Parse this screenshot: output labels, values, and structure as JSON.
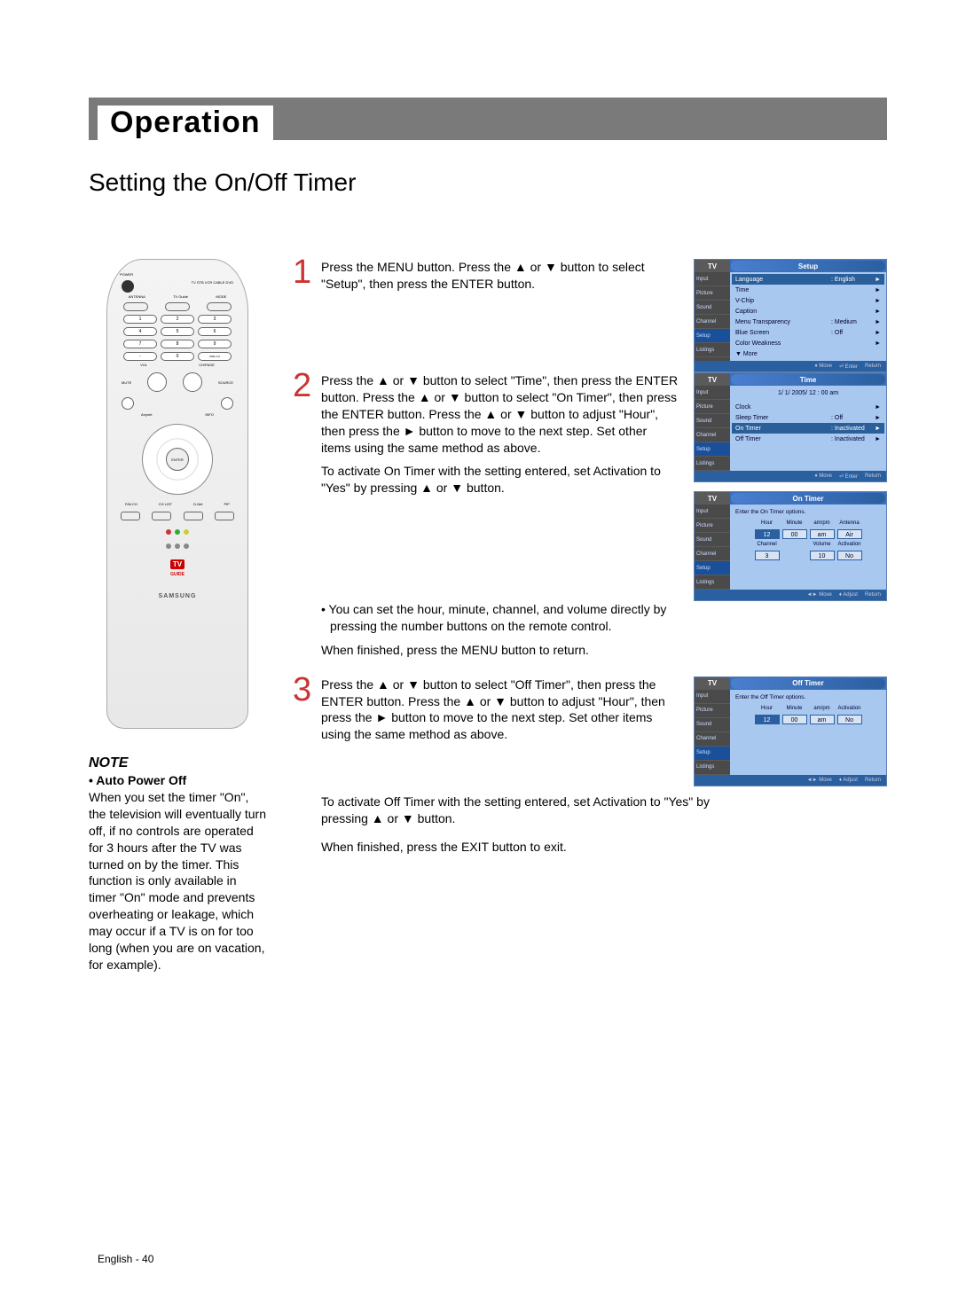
{
  "page": {
    "section": "Operation",
    "subtitle": "Setting the On/Off Timer",
    "footer": "English - 40"
  },
  "note": {
    "heading": "NOTE",
    "sub_bullet": "• Auto Power Off",
    "body": "When you set the timer \"On\", the television will eventually turn off, if no controls are operated for 3 hours after the TV was turned on by the timer. This function is only available in timer \"On\" mode and prevents overheating or leakage, which may occur if a TV is on for too long (when you are on vacation, for example)."
  },
  "remote": {
    "power_label": "POWER",
    "devices": "TV  STB  VCR  CABLE  DVD",
    "row1": [
      "ANTENNA",
      "TV Guide",
      "MODE"
    ],
    "numbers": [
      "1",
      "2",
      "3",
      "4",
      "5",
      "6",
      "7",
      "8",
      "9",
      "-",
      "0",
      "PRE-CH"
    ],
    "vol": "VOL",
    "ch": "CH/PAGE",
    "mute": "MUTE",
    "source": "SOURCE",
    "anynet": "Anynet",
    "info": "INFO",
    "enter": "ENTER",
    "bottom": [
      "FAV.CH",
      "CH LIST",
      "D-Net",
      "PIP"
    ],
    "tv_guide_logo": "TV GUIDE",
    "brand": "SAMSUNG"
  },
  "steps": {
    "s1": {
      "num": "1",
      "text": "Press the MENU button. Press the ▲ or ▼ button to select \"Setup\", then press the ENTER button."
    },
    "s2": {
      "num": "2",
      "text1": "Press the ▲ or ▼ button to select \"Time\", then press the ENTER button. Press the ▲ or ▼ button to select \"On Timer\", then press the ENTER button. Press the ▲ or ▼ button to adjust \"Hour\", then press the ► button to move to the next step. Set other items using the same method as above.",
      "text2": "To activate On Timer with the setting entered, set Activation to \"Yes\" by pressing ▲ or ▼ button."
    },
    "s2_bullet": "• You can set the hour, minute, channel, and volume directly by pressing the number buttons on the remote control.",
    "s2_tail": "When finished, press the MENU button to return.",
    "s3": {
      "num": "3",
      "text": "Press the ▲ or ▼ button to select \"Off Timer\", then press the ENTER button. Press the ▲ or ▼ button to adjust \"Hour\", then press the ► button to move to the next step. Set other items using the same method as above."
    },
    "s3_tail1": "To activate Off Timer with the setting entered, set Activation to \"Yes\" by pressing ▲ or ▼ button.",
    "s3_tail2": "When finished, press the EXIT button to exit."
  },
  "osd_common": {
    "tv": "TV",
    "side_items": [
      "Input",
      "Picture",
      "Sound",
      "Channel",
      "Setup",
      "Listings"
    ],
    "foot_move": "Move",
    "foot_enter": "Enter",
    "foot_return": "Return",
    "foot_adjust": "Adjust"
  },
  "osd_setup": {
    "title": "Setup",
    "rows": [
      {
        "l": "Language",
        "v": ": English"
      },
      {
        "l": "Time",
        "v": ""
      },
      {
        "l": "V-Chip",
        "v": ""
      },
      {
        "l": "Caption",
        "v": ""
      },
      {
        "l": "Menu Transparency",
        "v": ": Medium"
      },
      {
        "l": "Blue Screen",
        "v": ": Off"
      },
      {
        "l": "Color Weakness",
        "v": ""
      },
      {
        "l": "▼ More",
        "v": "",
        "noarrow": true
      }
    ]
  },
  "osd_time": {
    "title": "Time",
    "header": "1/  1/ 2005/ 12 : 00 am",
    "rows": [
      {
        "l": "Clock",
        "v": ""
      },
      {
        "l": "Sleep Timer",
        "v": ": Off"
      },
      {
        "l": "On Timer",
        "v": ": Inactivated",
        "sel": true
      },
      {
        "l": "Off Timer",
        "v": ": Inactivated"
      }
    ]
  },
  "osd_ontimer": {
    "title": "On Timer",
    "hint": "Enter the On Timer options.",
    "headers1": [
      "Hour",
      "Minute",
      "am/pm",
      "Antenna"
    ],
    "values1": [
      "12",
      "00",
      "am",
      "Air"
    ],
    "headers2": [
      "Channel",
      "",
      "Volume",
      "Activation"
    ],
    "values2": [
      "3",
      "",
      "10",
      "No"
    ]
  },
  "osd_offtimer": {
    "title": "Off Timer",
    "hint": "Enter the Off Timer options.",
    "headers1": [
      "Hour",
      "Minute",
      "am/pm",
      "Activation"
    ],
    "values1": [
      "12",
      "00",
      "am",
      "No"
    ]
  }
}
